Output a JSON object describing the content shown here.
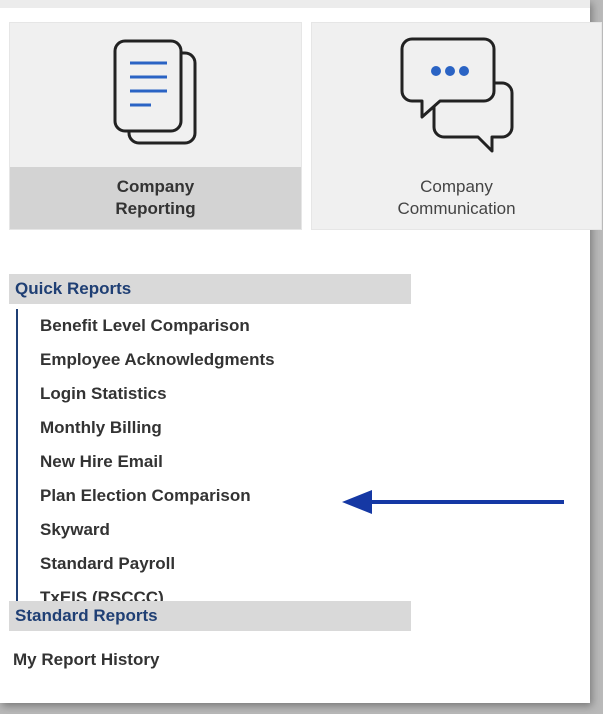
{
  "tiles": [
    {
      "line1": "Company",
      "line2": "Reporting",
      "icon": "documents-icon",
      "selected": true
    },
    {
      "line1": "Company",
      "line2": "Communication",
      "icon": "chat-bubbles-icon",
      "selected": false
    }
  ],
  "quick_reports": {
    "header": "Quick Reports",
    "items": [
      "Benefit Level Comparison",
      "Employee Acknowledgments",
      "Login Statistics",
      "Monthly Billing",
      "New Hire Email",
      "Plan Election Comparison",
      "Skyward",
      "Standard Payroll",
      "TxEIS (RSCCC)"
    ]
  },
  "standard_reports": {
    "header": "Standard Reports"
  },
  "my_report_history": "My Report History",
  "annotation": {
    "icon": "arrow-left-icon",
    "color": "#1538a4"
  },
  "colors": {
    "accent": "#1f3f74",
    "selected_band": "#d3d3d3",
    "header_bg": "#d9d9d9"
  }
}
